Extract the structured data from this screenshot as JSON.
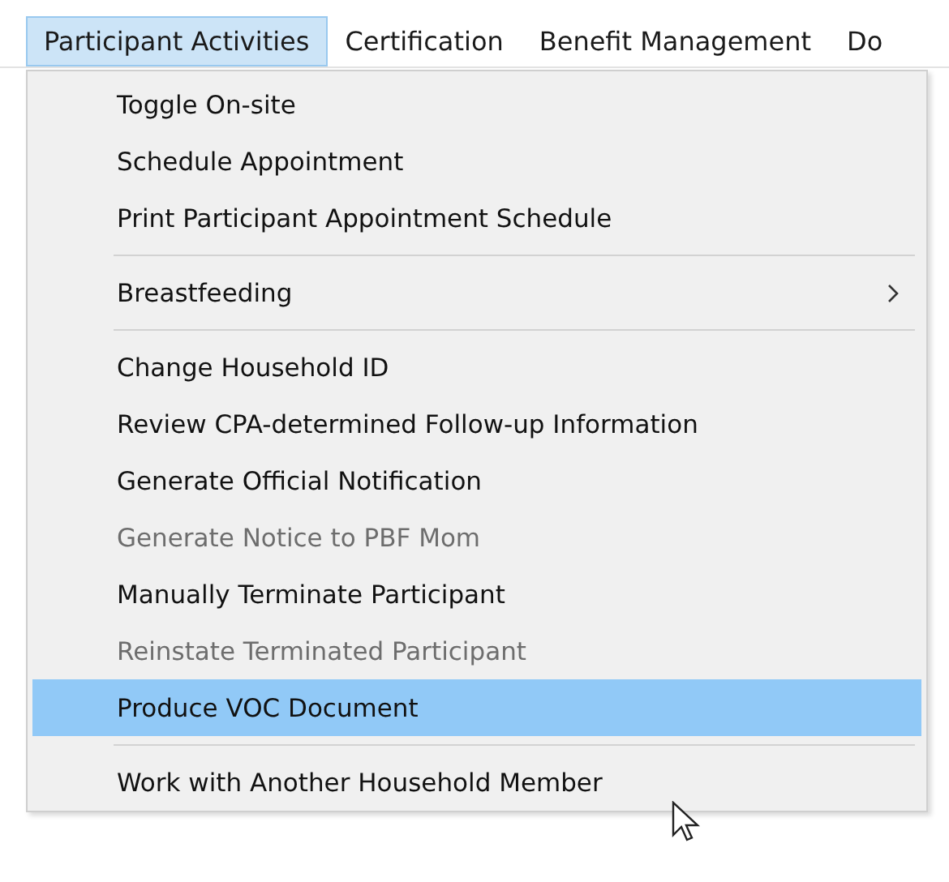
{
  "menu_bar": [
    {
      "label": "Participant Activities",
      "selected": true
    },
    {
      "label": "Certification",
      "selected": false
    },
    {
      "label": "Benefit Management",
      "selected": false
    },
    {
      "label": "Do",
      "selected": false
    }
  ],
  "menu": [
    {
      "kind": "item",
      "label": "Toggle On-site",
      "disabled": false,
      "selected": false,
      "submenu": false
    },
    {
      "kind": "item",
      "label": "Schedule Appointment",
      "disabled": false,
      "selected": false,
      "submenu": false
    },
    {
      "kind": "item",
      "label": "Print Participant Appointment Schedule",
      "disabled": false,
      "selected": false,
      "submenu": false
    },
    {
      "kind": "separator"
    },
    {
      "kind": "item",
      "label": "Breastfeeding",
      "disabled": false,
      "selected": false,
      "submenu": true
    },
    {
      "kind": "separator"
    },
    {
      "kind": "item",
      "label": "Change Household ID",
      "disabled": false,
      "selected": false,
      "submenu": false
    },
    {
      "kind": "item",
      "label": "Review CPA-determined Follow-up Information",
      "disabled": false,
      "selected": false,
      "submenu": false
    },
    {
      "kind": "item",
      "label": "Generate Official Notification",
      "disabled": false,
      "selected": false,
      "submenu": false
    },
    {
      "kind": "item",
      "label": "Generate Notice to PBF Mom",
      "disabled": true,
      "selected": false,
      "submenu": false
    },
    {
      "kind": "item",
      "label": "Manually Terminate Participant",
      "disabled": false,
      "selected": false,
      "submenu": false
    },
    {
      "kind": "item",
      "label": "Reinstate Terminated Participant",
      "disabled": true,
      "selected": false,
      "submenu": false
    },
    {
      "kind": "item",
      "label": "Produce VOC Document",
      "disabled": false,
      "selected": true,
      "submenu": false
    },
    {
      "kind": "separator"
    },
    {
      "kind": "item",
      "label": "Work with Another Household Member",
      "disabled": false,
      "selected": false,
      "submenu": false
    }
  ]
}
